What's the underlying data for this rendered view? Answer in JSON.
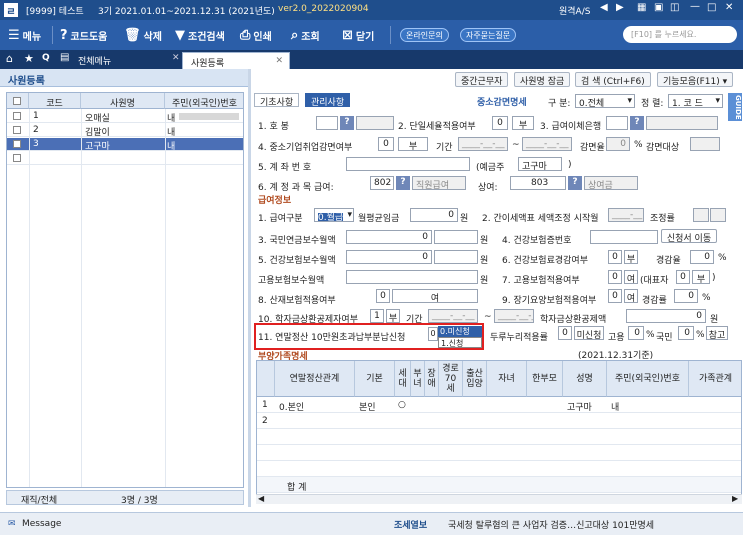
{
  "titlebar": {
    "company": "[9999] 테스트",
    "period": "3기 2021.01.01~2021.12.31 (2021년도)",
    "version": "ver2.0_2022020904",
    "as_label": "원격A/S"
  },
  "toolbar": {
    "menu": "메뉴",
    "help": "코드도움",
    "delete": "삭제",
    "condsearch": "조건검색",
    "print": "인쇄",
    "lookup": "조회",
    "close": "닫기",
    "online": "온라인문의",
    "faq": "자주묻는질문",
    "search_placeholder": "[F10] 를 누르세요."
  },
  "tabs": {
    "all_menu": "전체메뉴",
    "active": "사원등록"
  },
  "left": {
    "title": "사원등록",
    "headers": {
      "code": "코드",
      "name": "사원명",
      "rrn": "주민(외국인)번호"
    },
    "rows": [
      {
        "code": "1",
        "name": "오매실",
        "nat": "내"
      },
      {
        "code": "2",
        "name": "김말이",
        "nat": "내"
      },
      {
        "code": "3",
        "name": "고구마",
        "nat": "내"
      }
    ],
    "footer_label": "재직/전체",
    "footer_value": "3명 / 3명"
  },
  "rightbar": {
    "b1": "중간근무자",
    "b2": "사원명 잠금",
    "b3": "검 색 (Ctrl+F6)",
    "b4": "기능모음(F11)"
  },
  "subtabs": {
    "basic": "기초사항",
    "mgmt": "관리사항",
    "reduction": "중소감면명세",
    "sort_label": "구 분:",
    "sort_value": "0.전체",
    "order_label": "정 렬:",
    "order_value": "1. 코 드"
  },
  "guide": "GUIDE",
  "form": {
    "f1": "1. 호  봉",
    "f2": "2. 단일세율적용여부",
    "f2v": "0",
    "f2b": "부",
    "f3": "3. 급여이체은행",
    "f4": "4. 중소기업취업감면여부",
    "f4v": "0",
    "f4b": "부",
    "period_label": "기간",
    "date_ph": "____-__-__",
    "tilde": "~",
    "reduction_rate": "감면율",
    "rate_v": "0",
    "pct": "%",
    "reduction_target": "감면대상",
    "f5": "5. 계  좌  번  호",
    "holder_prefix": "(예금주",
    "holder": "고구마",
    "holder_suffix": ")",
    "f6": "6. 계 정 과 목  급여:",
    "acct1": "802",
    "acct1_name": "직원급여",
    "bonus": "상여:",
    "acct2": "803",
    "acct2_name": "상여금"
  },
  "pay": {
    "section": "급여정보",
    "g1": "1. 급여구분",
    "g1v": "0.월급",
    "monthly": "월평균임금",
    "monthly_v": "0",
    "won": "원",
    "g2": "2. 간이세액표 세액조정 시작월",
    "g2dash": "____-__",
    "adj": "조정률",
    "g3": "3. 국민연금보수월액",
    "g3v": "0",
    "g4": "4. 건강보험증번호",
    "g4btn": "신청서 이동",
    "g5": "5. 건강보험보수월액",
    "g5v": "0",
    "g6": "6. 건강보험료경감여부",
    "g6v": "0",
    "g6b": "부",
    "reduce": "경감율",
    "reduce_v": "0",
    "g7label": "고용보험보수월액",
    "g7": "7. 고용보험적용여부",
    "g7v": "0",
    "g7b": "여",
    "rep": "(대표자",
    "rep_v": "0",
    "rep_b": "부",
    "rep_close": ")",
    "g8": "8. 산재보험적용여부",
    "g8v": "0",
    "g8b": "여",
    "g9": "9. 장기요양보험적용여부",
    "g9v": "0",
    "g9b": "여",
    "g9rate": "경감률",
    "g9rate_v": "0",
    "g10": "10. 학자금상환공제자여부",
    "g10v": "1",
    "g10b": "부",
    "g10p": "기간",
    "loan": "학자금상환공제액",
    "loan_v": "0",
    "g11": "11. 연말정산 10만원초과납부분납신청",
    "g11v": "0",
    "g11opt0": "0.미신청",
    "g11opt1": "1.신청",
    "durunuri": "두루누리적용률",
    "dv": "0",
    "dnone": "미신청",
    "employ": "고용",
    "ev": "0",
    "pension": "국민",
    "pv": "0",
    "ref": "참고"
  },
  "dependents": {
    "section": "부양가족명세",
    "asof": "(2021.12.31기준)",
    "headers": {
      "rel": "연말정산관계",
      "basic": "기본",
      "head": "세대",
      "wife": "부녀",
      "dis": "장애",
      "old": "경로70세",
      "birth": "출산입양",
      "child": "자녀",
      "single": "한부모",
      "name": "성명",
      "rrn": "주민(외국인)번호",
      "extra": "가족관계"
    },
    "rows": [
      {
        "no": "1",
        "rel": "0.본인",
        "basic": "본인",
        "head": "○",
        "name": "고구마",
        "nat": "내"
      },
      {
        "no": "2"
      }
    ],
    "total": "합   계"
  },
  "status": {
    "message": "Message",
    "label": "조세열보",
    "text": "국세청 탈루혐의 큰 사업자 검증…신고대상 101만명세"
  }
}
